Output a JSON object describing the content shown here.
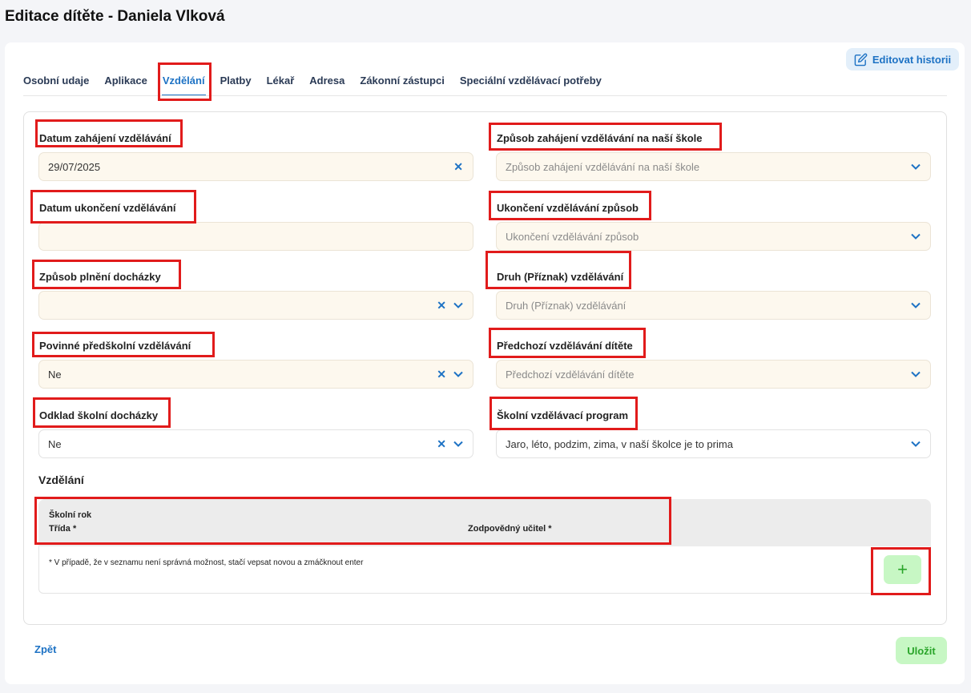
{
  "page": {
    "title": "Editace dítěte - Daniela Vlková"
  },
  "header": {
    "edit_history_label": "Editovat historii"
  },
  "tabs": [
    {
      "label": "Osobní udaje"
    },
    {
      "label": "Aplikace"
    },
    {
      "label": "Vzdělání",
      "active": true
    },
    {
      "label": "Platby"
    },
    {
      "label": "Lékař"
    },
    {
      "label": "Adresa"
    },
    {
      "label": "Zákonní zástupci"
    },
    {
      "label": "Speciální vzdělávací potřeby"
    }
  ],
  "form": {
    "start_date": {
      "label": "Datum zahájení vzdělávání",
      "value": "29/07/2025"
    },
    "end_date": {
      "label": "Datum ukončení vzdělávání",
      "value": ""
    },
    "attendance_mode": {
      "label": "Způsob plnění docházky",
      "value": ""
    },
    "mandatory_preschool": {
      "label": "Povinné předškolní vzdělávání",
      "value": "Ne"
    },
    "school_delay": {
      "label": "Odklad školní docházky",
      "value": "Ne"
    },
    "start_method": {
      "label": "Způsob zahájení vzdělávání na naší škole",
      "placeholder": "Způsob zahájení vzdělávání na naší škole"
    },
    "end_method": {
      "label": "Ukončení vzdělávání způsob",
      "placeholder": "Ukončení vzdělávání způsob"
    },
    "education_type": {
      "label": "Druh (Příznak) vzdělávání",
      "placeholder": "Druh (Příznak) vzdělávání"
    },
    "previous_education": {
      "label": "Předchozí vzdělávání dítěte",
      "placeholder": "Předchozí vzdělávání dítěte"
    },
    "school_program": {
      "label": "Školní vzdělávací program",
      "value": "Jaro, léto, podzim, zima, v naší školce je to prima"
    }
  },
  "education_table": {
    "title": "Vzdělání",
    "col_school_year": "Školní rok",
    "col_class": "Třída *",
    "col_teacher": "Zodpovědný učitel *",
    "note": "* V případě, že v seznamu není správná možnost, stačí vepsat novou a zmáčknout enter",
    "add_label": "+"
  },
  "footer": {
    "back_label": "Zpět",
    "save_label": "Uložit"
  },
  "colors": {
    "accent": "#1d72c4",
    "highlight": "#e11b1b",
    "success_bg": "#c7f7c4",
    "success_fg": "#2aa52a",
    "field_bg": "#fdf8ee"
  },
  "icons": {
    "edit": "edit-icon",
    "clear": "clear-icon",
    "dropdown": "chevron-down-icon",
    "add": "plus-icon"
  }
}
